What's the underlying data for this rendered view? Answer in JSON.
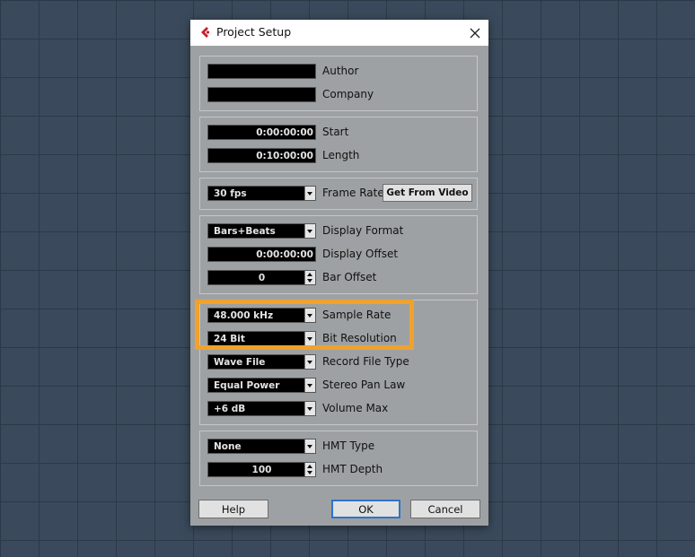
{
  "window": {
    "title": "Project Setup"
  },
  "fields": {
    "author": {
      "label": "Author",
      "value": ""
    },
    "company": {
      "label": "Company",
      "value": ""
    },
    "start": {
      "label": "Start",
      "value": "0:00:00:00"
    },
    "length": {
      "label": "Length",
      "value": "0:10:00:00"
    },
    "frame_rate": {
      "label": "Frame Rate",
      "value": "30 fps"
    },
    "get_from_video": {
      "label": "Get From Video"
    },
    "display_format": {
      "label": "Display Format",
      "value": "Bars+Beats"
    },
    "display_offset": {
      "label": "Display Offset",
      "value": "0:00:00:00"
    },
    "bar_offset": {
      "label": "Bar Offset",
      "value": "0"
    },
    "sample_rate": {
      "label": "Sample Rate",
      "value": "48.000 kHz"
    },
    "bit_resolution": {
      "label": "Bit Resolution",
      "value": "24 Bit"
    },
    "record_file_type": {
      "label": "Record File Type",
      "value": "Wave File"
    },
    "stereo_pan_law": {
      "label": "Stereo Pan Law",
      "value": "Equal Power"
    },
    "volume_max": {
      "label": "Volume Max",
      "value": "+6 dB"
    },
    "hmt_type": {
      "label": "HMT Type",
      "value": "None"
    },
    "hmt_depth": {
      "label": "HMT Depth",
      "value": "100"
    }
  },
  "buttons": {
    "help": "Help",
    "ok": "OK",
    "cancel": "Cancel"
  },
  "colors": {
    "highlight": "#f0a22c",
    "logo": "#c8202e",
    "default_button_border": "#2f73c8"
  }
}
